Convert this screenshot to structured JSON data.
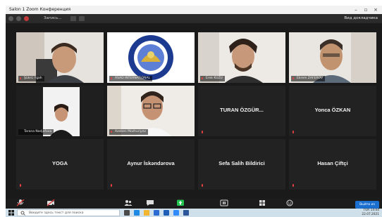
{
  "window": {
    "title": "Salon 1  Zoom Конференция"
  },
  "infobar": {
    "title": "Запись...",
    "view_label": "Вид докладчика"
  },
  "tiles": [
    {
      "name": "Şükrü Ygah",
      "kind": "video"
    },
    {
      "name": "ASAD INTERNATIONAL",
      "kind": "logo"
    },
    {
      "name": "Erek KUZU",
      "kind": "video"
    },
    {
      "name": "Ekrem ZAFEROV",
      "kind": "video"
    },
    {
      "name": "Tarana Nadjafova",
      "kind": "video"
    },
    {
      "name": "Azeben Mozhuriyev",
      "kind": "video"
    },
    {
      "name": "TURAN ÖZGÜR...",
      "kind": "name"
    },
    {
      "name": "Yonca ÖZKAN",
      "kind": "name"
    },
    {
      "name": "YOGA",
      "kind": "name"
    },
    {
      "name": "Aynur İskəndərova",
      "kind": "name"
    },
    {
      "name": "Sefa Salih Bildirici",
      "kind": "name"
    },
    {
      "name": "Hasan Çiftçi",
      "kind": "name"
    }
  ],
  "toolbar": {
    "mic": "Включить звук",
    "video": "Включить видео",
    "participants": "Участники",
    "participants_count": "48",
    "chat": "Чат",
    "share": "Демонстрация экрана",
    "record": "Приостановить запись",
    "rooms": "Сессионные залы",
    "reactions": "Реакции",
    "end": "Выйти из зала"
  },
  "taskbar": {
    "search_placeholder": "Введите здесь текст для поиска",
    "time": "14:04",
    "date": "22.07.2021",
    "lang": "TUR"
  },
  "colors": {
    "active_outline": "#b6e34a",
    "muted_mic": "#e34040",
    "end_button": "#1b6fd1",
    "share_icon": "#23c34f"
  }
}
